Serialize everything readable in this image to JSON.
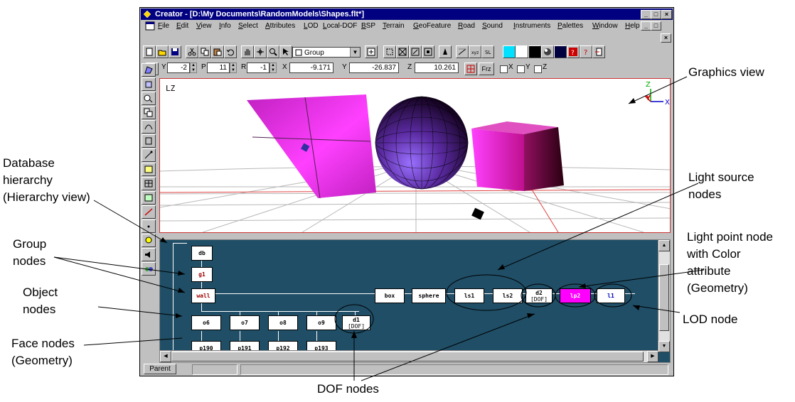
{
  "window": {
    "title": "Creator - [D:\\My Documents\\RandomModels\\Shapes.flt*]",
    "min_glyph": "_",
    "max_glyph": "□",
    "close_glyph": "×"
  },
  "menu": [
    "File",
    "Edit",
    "View",
    "Info",
    "Select",
    "Attributes",
    "LOD",
    "Local-DOF",
    "BSP",
    "Terrain",
    "GeoFeature",
    "Road",
    "Sound",
    "Instruments",
    "Palettes",
    "Window",
    "Help"
  ],
  "toolbar": {
    "mode_combo": "Group"
  },
  "coords": {
    "y_label": "Y",
    "y_value": "-2",
    "p_label": "P",
    "p_value": "11",
    "r_label": "R",
    "r_value": "-1",
    "x_label": "X",
    "x_value": "-9.171",
    "y2_label": "Y",
    "y2_value": "-26.837",
    "z_label": "Z",
    "z_value": "10.261",
    "frz_label": "Frz",
    "chk_x": "X",
    "chk_y": "Y",
    "chk_z": "Z"
  },
  "graphics": {
    "lz_label": "LZ",
    "axis_z": "Z",
    "axis_y": "Y",
    "axis_x": "X"
  },
  "nodes": {
    "db": "db",
    "g1": "g1",
    "wall": "wall",
    "o6": "o6",
    "o7": "o7",
    "o8": "o8",
    "o9": "o9",
    "d1": "d1",
    "d1_sub": "[DOF]",
    "p190": "p190",
    "p191": "p191",
    "p192": "p192",
    "p193": "p193",
    "box": "box",
    "sphere": "sphere",
    "ls1": "ls1",
    "ls2": "ls2",
    "d2": "d2",
    "d2_sub": "[DOF]",
    "lp2": "lp2",
    "l1": "l1"
  },
  "status": {
    "parent": "Parent"
  },
  "annotations": {
    "graphics_view": "Graphics view",
    "db_hierarchy_1": "Database",
    "db_hierarchy_2": "hierarchy",
    "db_hierarchy_3": "(Hierarchy view)",
    "group_1": "Group",
    "group_2": "nodes",
    "object_1": "Object",
    "object_2": "nodes",
    "face_1": "Face nodes",
    "face_2": "(Geometry)",
    "light_source_1": "Light source",
    "light_source_2": "nodes",
    "light_point_1": "Light point node",
    "light_point_2": "with Color",
    "light_point_3": "attribute",
    "light_point_4": "(Geometry)",
    "lod": "LOD node",
    "dof": "DOF nodes"
  },
  "colors": {
    "title_bar": "#000080",
    "hierarchy_bg": "#1f4e66",
    "light_point": "#ff00ff",
    "shape_magenta": "#cc22cc"
  }
}
